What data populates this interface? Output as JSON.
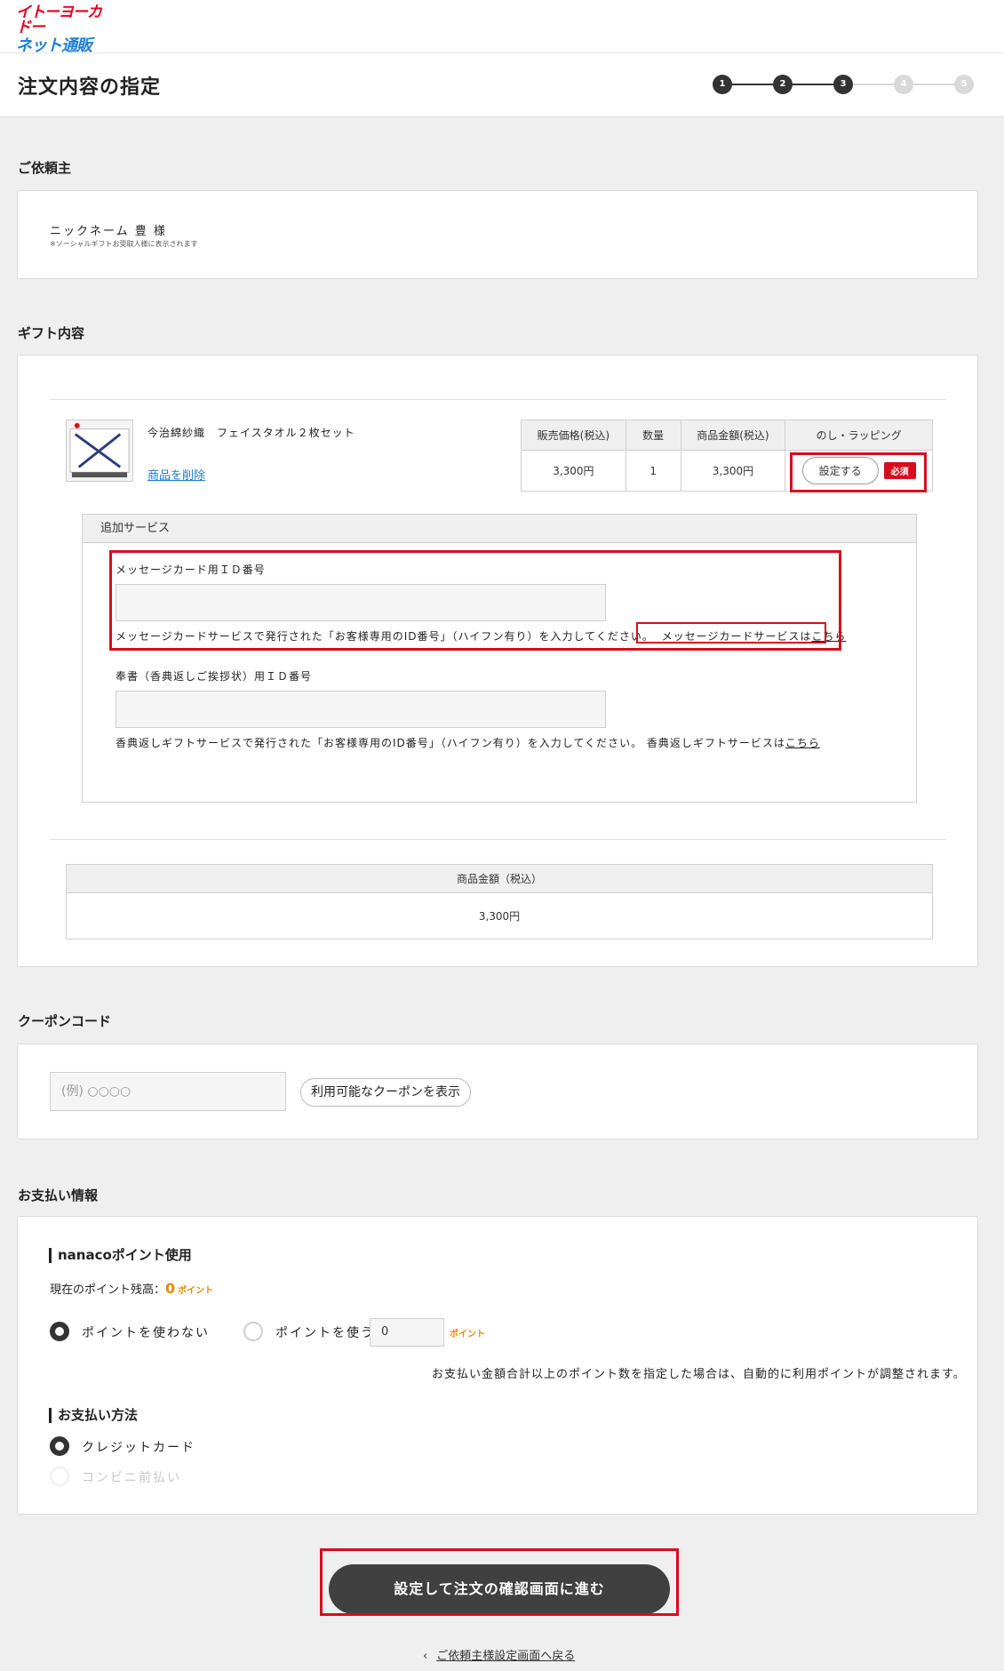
{
  "brand": {
    "line1": "イトーヨーカドー",
    "line2": "ネット通販"
  },
  "header": {
    "title": "注文内容の指定"
  },
  "steps": [
    "1",
    "2",
    "3",
    "4",
    "5"
  ],
  "requester": {
    "section_title": "ご依頼主",
    "name": "ニックネーム 豊 様",
    "note": "※ソーシャルギフトお受取人様に表示されます"
  },
  "gift": {
    "section_title": "ギフト内容",
    "product_name": "今治綿紗織　フェイスタオル２枚セット",
    "delete_label": "商品を削除",
    "table": {
      "headers": [
        "販売価格(税込)",
        "数量",
        "商品金額(税込)",
        "のし・ラッピング"
      ],
      "price": "3,300円",
      "qty": "1",
      "amount": "3,300円",
      "set_button": "設定する",
      "required": "必須"
    },
    "additional": {
      "title": "追加サービス",
      "message_label": "メッセージカード用ＩＤ番号",
      "message_help": "メッセージカードサービスで発行された「お客様専用のID番号」（ハイフン有り）を入力してください。",
      "message_link_prefix": "メッセージカードサービスは",
      "message_link": "こちら",
      "housho_label": "奉書（香典返しご挨拶状）用ＩＤ番号",
      "housho_help": "香典返しギフトサービスで発行された「お客様専用のID番号」（ハイフン有り）を入力してください。 香典返しギフトサービスは",
      "housho_link": "こちら"
    },
    "total_header": "商品金額（税込）",
    "total_value": "3,300円"
  },
  "coupon": {
    "section_title": "クーポンコード",
    "placeholder": "(例) ○○○○",
    "show_button": "利用可能なクーポンを表示"
  },
  "payment": {
    "section_title": "お支払い情報",
    "nanaco_title": "nanacoポイント使用",
    "balance_label": "現在のポイント残高：",
    "balance_value": "0",
    "point_unit": "ポイント",
    "no_use": "ポイントを使わない",
    "use": "ポイントを使う",
    "use_value": "0",
    "adjust_note": "お支払い金額合計以上のポイント数を指定した場合は、自動的に利用ポイントが調整されます。",
    "method_title": "お支払い方法",
    "credit": "クレジットカード",
    "convenience": "コンビニ前払い"
  },
  "actions": {
    "proceed": "設定して注文の確認画面に進む",
    "back_arrow": "‹",
    "back": "ご依頼主様設定画面へ戻る"
  },
  "colors": {
    "accent_red": "#d70d1e",
    "point_orange": "#e48a00",
    "dark_button": "#404040"
  }
}
